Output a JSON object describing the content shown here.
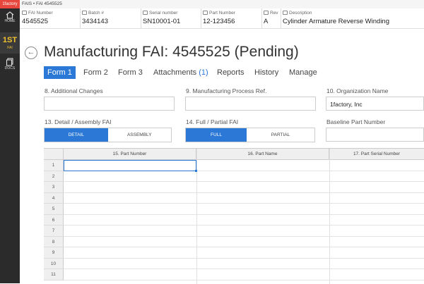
{
  "app": {
    "brand": "1factory",
    "breadcrumb": "FAIS • FAI 4545525"
  },
  "sidebar": {
    "items": [
      {
        "label": "HOME"
      },
      {
        "label": "FAI",
        "badge": "1ST"
      },
      {
        "label": "DOCS"
      }
    ]
  },
  "infobar": {
    "fai_number": {
      "label": "FAI Number",
      "value": "4545525"
    },
    "batch": {
      "label": "Batch #",
      "value": "3434143"
    },
    "serial": {
      "label": "Serial number",
      "value": "SN10001-01"
    },
    "part": {
      "label": "Part Number",
      "value": "12-123456"
    },
    "rev": {
      "label": "Rev",
      "value": "A"
    },
    "description": {
      "label": "Description",
      "value": "Cylinder Armature Reverse Winding"
    }
  },
  "page": {
    "title": "Manufacturing FAI: 4545525 (Pending)"
  },
  "tabs": [
    {
      "label": "Form 1"
    },
    {
      "label": "Form 2"
    },
    {
      "label": "Form 3"
    },
    {
      "label": "Attachments",
      "count": "(1)"
    },
    {
      "label": "Reports"
    },
    {
      "label": "History"
    },
    {
      "label": "Manage"
    }
  ],
  "form": {
    "f8": {
      "label": "8. Additional Changes",
      "value": ""
    },
    "f9": {
      "label": "9. Manufacturing Process Ref.",
      "value": ""
    },
    "f10": {
      "label": "10. Organization Name",
      "value": "1factory, Inc"
    },
    "f13": {
      "label": "13. Detail / Assembly FAI",
      "options": [
        "DETAIL",
        "ASSEMBLY"
      ],
      "selected": "DETAIL"
    },
    "f14": {
      "label": "14. Full / Partial FAI",
      "options": [
        "FULL",
        "PARTIAL"
      ],
      "selected": "FULL"
    },
    "baseline": {
      "label": "Baseline Part Number",
      "value": ""
    }
  },
  "grid": {
    "columns": [
      "15. Part Number",
      "16. Part Name",
      "17. Part Serial Number"
    ],
    "row_numbers": [
      "1",
      "2",
      "3",
      "4",
      "5",
      "6",
      "7",
      "8",
      "9",
      "10",
      "11"
    ]
  },
  "colors": {
    "accent": "#2b78d6",
    "brand": "#e8463c",
    "sidebar": "#2b2b2b",
    "badge": "#f2c230"
  }
}
